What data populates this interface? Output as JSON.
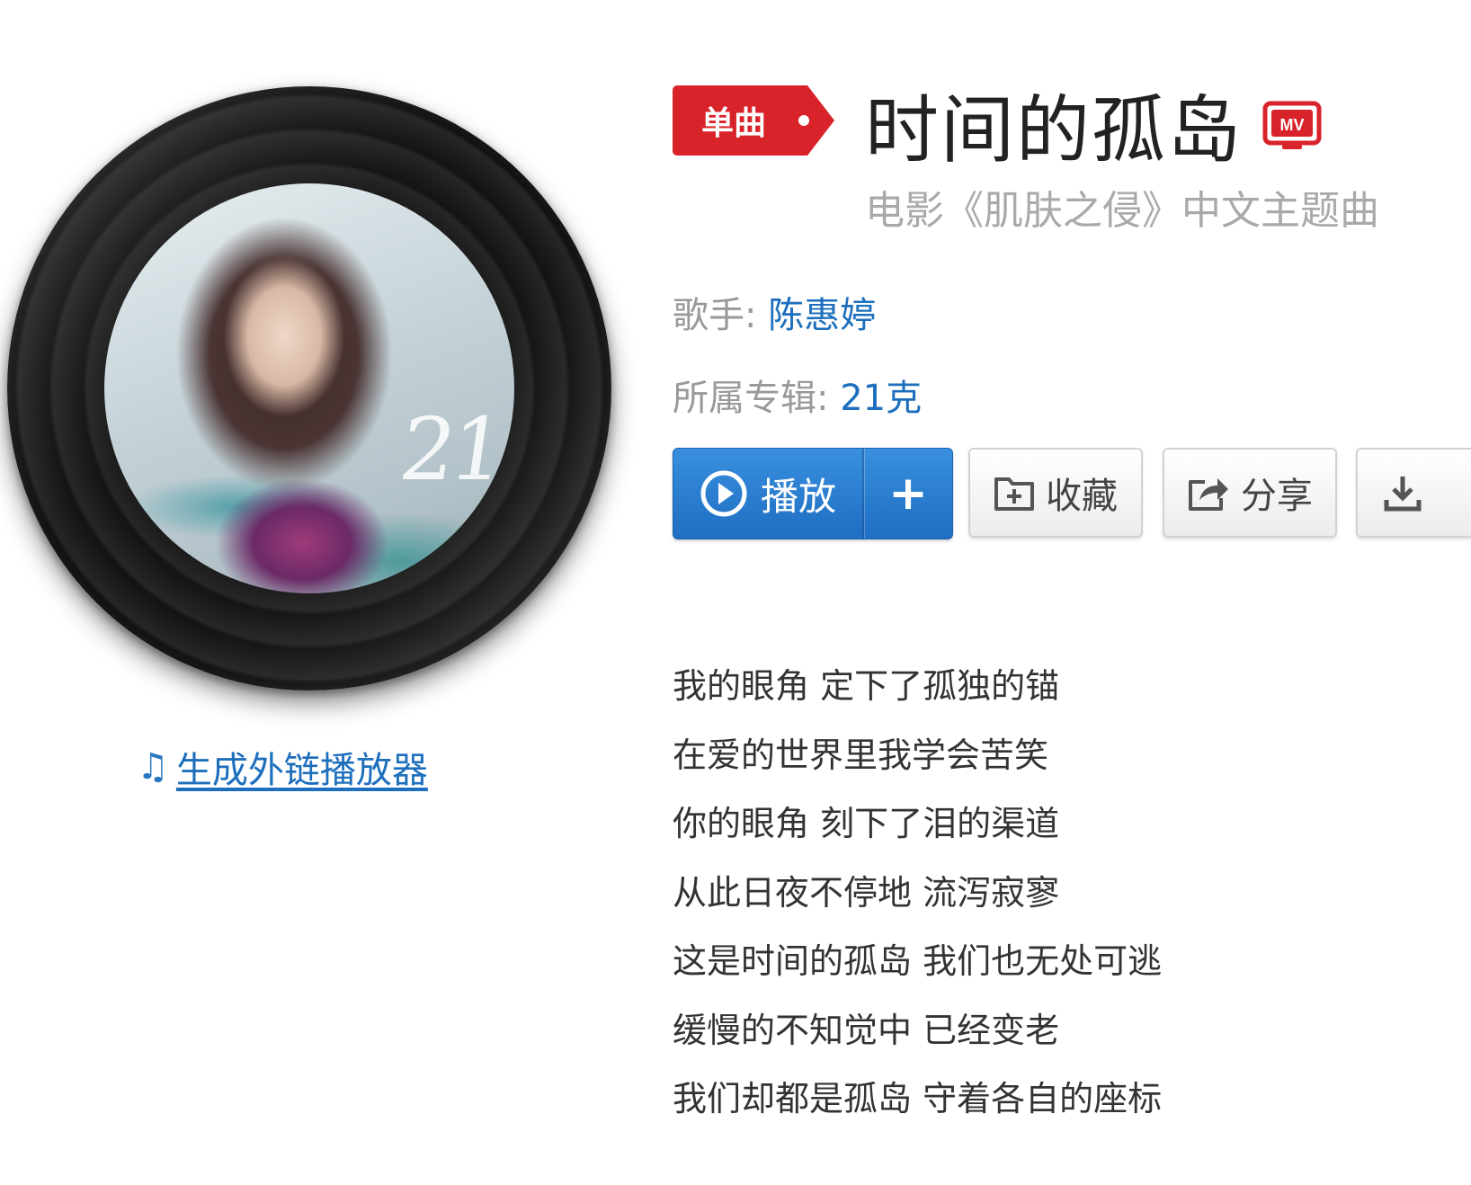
{
  "song": {
    "badge_label": "单曲",
    "title": "时间的孤岛",
    "mv_badge": "MV",
    "subtitle": "电影《肌肤之侵》中文主题曲"
  },
  "meta": {
    "singer_key": "歌手:",
    "singer_value": "陈惠婷",
    "album_key": "所属专辑:",
    "album_value": "21克"
  },
  "album_cover": {
    "overlay_text": "21"
  },
  "actions": {
    "play_label": "播放",
    "add_label": "+",
    "collect_label": "收藏",
    "share_label": "分享"
  },
  "external_player": {
    "label": "生成外链播放器"
  },
  "lyrics": [
    "我的眼角 定下了孤独的锚",
    "在爱的世界里我学会苦笑",
    "你的眼角 刻下了泪的渠道",
    "从此日夜不停地 流泻寂寥",
    "这是时间的孤岛 我们也无处可逃",
    "缓慢的不知觉中 已经变老",
    "我们却都是孤岛 守着各自的座标"
  ],
  "colors": {
    "accent_blue": "#1d6fbd",
    "badge_red": "#d9232a",
    "muted_gray": "#a9a9a9"
  },
  "icons": {
    "play": "play-circle-icon",
    "collect": "folder-plus-icon",
    "share": "share-arrow-icon",
    "download": "download-icon",
    "music_note": "music-note-icon",
    "mv": "mv-tv-icon"
  }
}
